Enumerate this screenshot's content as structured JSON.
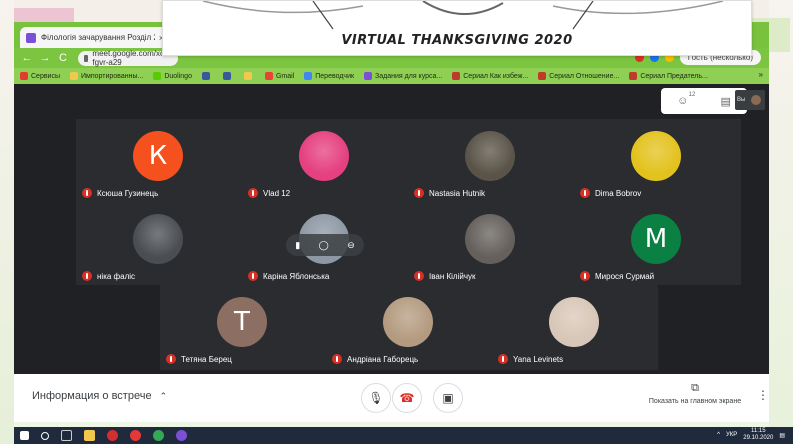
{
  "banner": {
    "title": "VIRTUAL THANKSGIVING 2020"
  },
  "browser": {
    "tab_title": "Філологія зачарування Розділ 2",
    "tab_close": "×",
    "address": "meet.google.com/xon-fgvr-a29",
    "guest_label": "Гость (несколько)",
    "nav_back": "←",
    "nav_forward": "→",
    "nav_reload": "C"
  },
  "bookmarks": [
    {
      "label": "Сервисы",
      "color": "#e33b2e"
    },
    {
      "label": "Импортированны...",
      "color": "#f2c94c"
    },
    {
      "label": "Duolingo",
      "color": "#58cc02"
    },
    {
      "label": "",
      "color": "#3b5998"
    },
    {
      "label": "",
      "color": "#3b5998"
    },
    {
      "label": "",
      "color": "#f2c94c"
    },
    {
      "label": "Gmail",
      "color": "#ea4335"
    },
    {
      "label": "Переводчик",
      "color": "#4285f4"
    },
    {
      "label": "Задания для курса...",
      "color": "#7b4fd6"
    },
    {
      "label": "Сериал Как избеж...",
      "color": "#c0392b"
    },
    {
      "label": "Сериал Отношение...",
      "color": "#c0392b"
    },
    {
      "label": "Сериал Предатель...",
      "color": "#c0392b"
    }
  ],
  "bookmarks_more": "»",
  "meet": {
    "participants_count": "12",
    "self_label": "Вы",
    "participants": [
      {
        "name": "Ксюша Гузинець",
        "initial": "К",
        "color": "#f4511e"
      },
      {
        "name": "Vlad 12",
        "initial": "",
        "color": "#e5407f"
      },
      {
        "name": "Nastasia Hutnik",
        "initial": "",
        "color": "#5a5448"
      },
      {
        "name": "Dima Bobrov",
        "initial": "",
        "color": "#e3c21d"
      },
      {
        "name": "ніка фаліс",
        "initial": "",
        "color": "#4a4d52"
      },
      {
        "name": "Каріна Яблонська",
        "initial": "",
        "color": "#8e98a4"
      },
      {
        "name": "Іван Кілійчук",
        "initial": "",
        "color": "#65605c"
      },
      {
        "name": "Мирося Сурмай",
        "initial": "M",
        "color": "#0b8043"
      },
      {
        "name": "Тетяна Берец",
        "initial": "T",
        "color": "#8d6e63"
      },
      {
        "name": "Андріана Габорець",
        "initial": "",
        "color": "#b49b80"
      },
      {
        "name": "Yana Levinets",
        "initial": "",
        "color": "#d8c7b8"
      }
    ]
  },
  "bottom": {
    "meeting_info": "Информация о встрече",
    "present_label": "Показать на главном экране",
    "more": "⋮"
  },
  "taskbar": {
    "lang": "УКР",
    "time": "11:15",
    "date": "29.10.2020"
  }
}
